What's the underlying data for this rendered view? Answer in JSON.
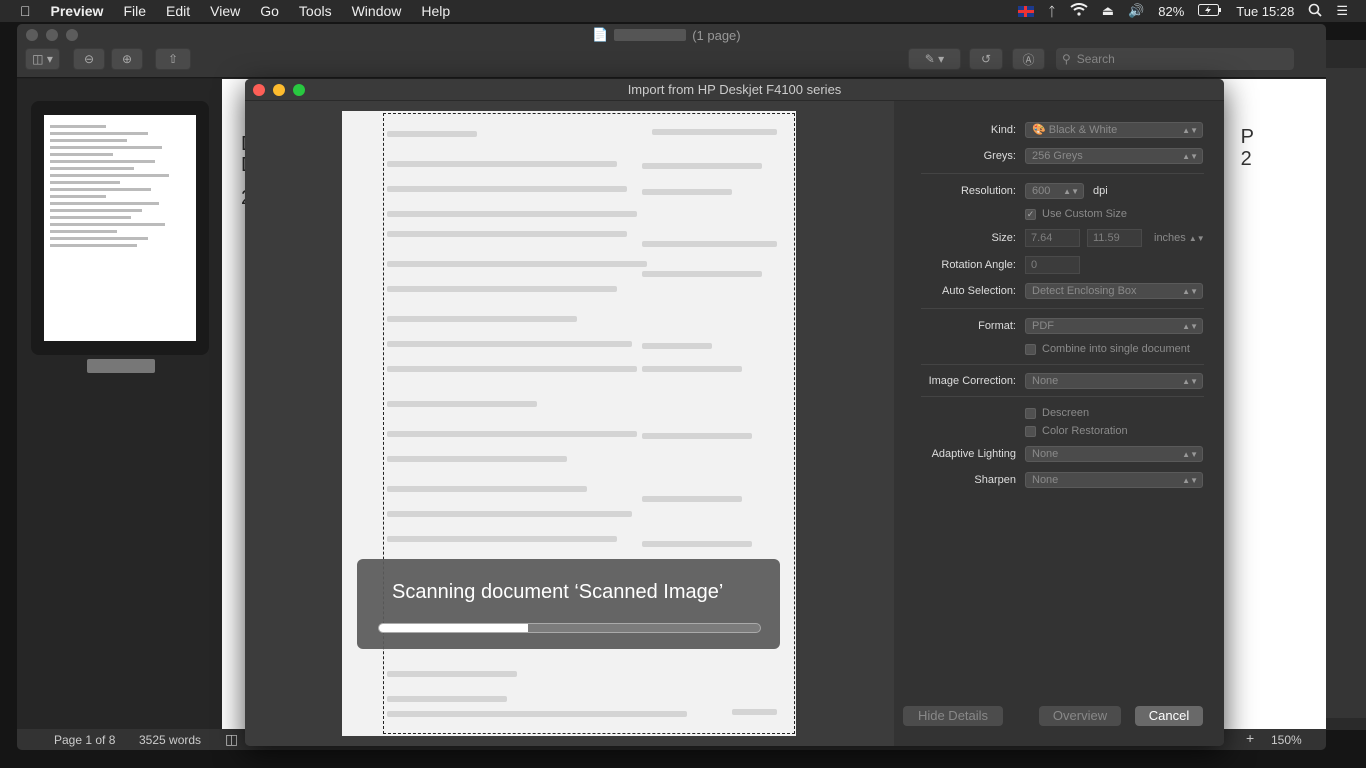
{
  "menubar": {
    "items": [
      "Preview",
      "File",
      "Edit",
      "View",
      "Go",
      "Tools",
      "Window",
      "Help"
    ],
    "battery": "82%",
    "clock": "Tue 15:28"
  },
  "preview": {
    "title_suffix": "(1 page)",
    "search_placeholder": "Search",
    "status": {
      "page": "Page 1 of 8",
      "words": "3525 words",
      "zoom": "150%"
    },
    "doc_left_letters": [
      "D",
      "D",
      "",
      "2",
      "",
      ""
    ],
    "doc_right_letters": [
      "P",
      "2"
    ]
  },
  "dialog": {
    "title": "Import from HP Deskjet F4100 series",
    "scan": {
      "message": "Scanning document ‘Scanned Image’",
      "progress": 0.39
    },
    "kind": {
      "label": "Kind:",
      "value": "Black & White"
    },
    "greys": {
      "label": "Greys:",
      "value": "256 Greys"
    },
    "resolution": {
      "label": "Resolution:",
      "value": "600",
      "unit": "dpi"
    },
    "custom_size": {
      "label": "Use Custom Size",
      "checked": true
    },
    "size": {
      "label": "Size:",
      "width": "7.64",
      "height": "11.59",
      "unit": "inches"
    },
    "rotation": {
      "label": "Rotation Angle:",
      "value": "0"
    },
    "auto_selection": {
      "label": "Auto Selection:",
      "value": "Detect Enclosing Box"
    },
    "format": {
      "label": "Format:",
      "value": "PDF"
    },
    "combine": {
      "label": "Combine into single document",
      "checked": false
    },
    "image_correction": {
      "label": "Image Correction:",
      "value": "None"
    },
    "descreen": {
      "label": "Descreen",
      "checked": false
    },
    "color_restoration": {
      "label": "Color Restoration",
      "checked": false
    },
    "adaptive_lighting": {
      "label": "Adaptive Lighting",
      "value": "None"
    },
    "sharpen": {
      "label": "Sharpen",
      "value": "None"
    },
    "buttons": {
      "hide_details": "Hide Details",
      "overview": "Overview",
      "cancel": "Cancel"
    }
  }
}
